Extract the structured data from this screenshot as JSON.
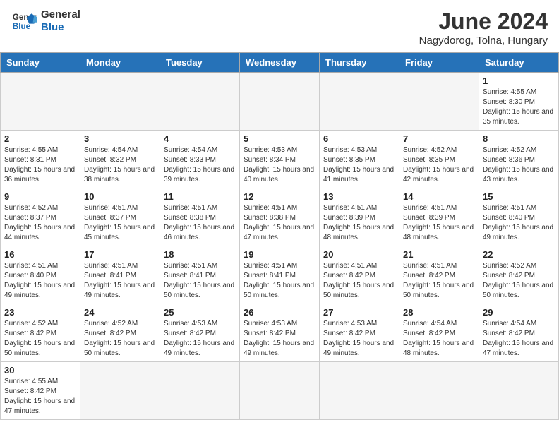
{
  "header": {
    "logo_general": "General",
    "logo_blue": "Blue",
    "title": "June 2024",
    "subtitle": "Nagydorog, Tolna, Hungary"
  },
  "weekdays": [
    "Sunday",
    "Monday",
    "Tuesday",
    "Wednesday",
    "Thursday",
    "Friday",
    "Saturday"
  ],
  "weeks": [
    [
      {
        "day": "",
        "info": ""
      },
      {
        "day": "",
        "info": ""
      },
      {
        "day": "",
        "info": ""
      },
      {
        "day": "",
        "info": ""
      },
      {
        "day": "",
        "info": ""
      },
      {
        "day": "",
        "info": ""
      },
      {
        "day": "1",
        "info": "Sunrise: 4:55 AM\nSunset: 8:30 PM\nDaylight: 15 hours and 35 minutes."
      }
    ],
    [
      {
        "day": "2",
        "info": "Sunrise: 4:55 AM\nSunset: 8:31 PM\nDaylight: 15 hours and 36 minutes."
      },
      {
        "day": "3",
        "info": "Sunrise: 4:54 AM\nSunset: 8:32 PM\nDaylight: 15 hours and 38 minutes."
      },
      {
        "day": "4",
        "info": "Sunrise: 4:54 AM\nSunset: 8:33 PM\nDaylight: 15 hours and 39 minutes."
      },
      {
        "day": "5",
        "info": "Sunrise: 4:53 AM\nSunset: 8:34 PM\nDaylight: 15 hours and 40 minutes."
      },
      {
        "day": "6",
        "info": "Sunrise: 4:53 AM\nSunset: 8:35 PM\nDaylight: 15 hours and 41 minutes."
      },
      {
        "day": "7",
        "info": "Sunrise: 4:52 AM\nSunset: 8:35 PM\nDaylight: 15 hours and 42 minutes."
      },
      {
        "day": "8",
        "info": "Sunrise: 4:52 AM\nSunset: 8:36 PM\nDaylight: 15 hours and 43 minutes."
      }
    ],
    [
      {
        "day": "9",
        "info": "Sunrise: 4:52 AM\nSunset: 8:37 PM\nDaylight: 15 hours and 44 minutes."
      },
      {
        "day": "10",
        "info": "Sunrise: 4:51 AM\nSunset: 8:37 PM\nDaylight: 15 hours and 45 minutes."
      },
      {
        "day": "11",
        "info": "Sunrise: 4:51 AM\nSunset: 8:38 PM\nDaylight: 15 hours and 46 minutes."
      },
      {
        "day": "12",
        "info": "Sunrise: 4:51 AM\nSunset: 8:38 PM\nDaylight: 15 hours and 47 minutes."
      },
      {
        "day": "13",
        "info": "Sunrise: 4:51 AM\nSunset: 8:39 PM\nDaylight: 15 hours and 48 minutes."
      },
      {
        "day": "14",
        "info": "Sunrise: 4:51 AM\nSunset: 8:39 PM\nDaylight: 15 hours and 48 minutes."
      },
      {
        "day": "15",
        "info": "Sunrise: 4:51 AM\nSunset: 8:40 PM\nDaylight: 15 hours and 49 minutes."
      }
    ],
    [
      {
        "day": "16",
        "info": "Sunrise: 4:51 AM\nSunset: 8:40 PM\nDaylight: 15 hours and 49 minutes."
      },
      {
        "day": "17",
        "info": "Sunrise: 4:51 AM\nSunset: 8:41 PM\nDaylight: 15 hours and 49 minutes."
      },
      {
        "day": "18",
        "info": "Sunrise: 4:51 AM\nSunset: 8:41 PM\nDaylight: 15 hours and 50 minutes."
      },
      {
        "day": "19",
        "info": "Sunrise: 4:51 AM\nSunset: 8:41 PM\nDaylight: 15 hours and 50 minutes."
      },
      {
        "day": "20",
        "info": "Sunrise: 4:51 AM\nSunset: 8:42 PM\nDaylight: 15 hours and 50 minutes."
      },
      {
        "day": "21",
        "info": "Sunrise: 4:51 AM\nSunset: 8:42 PM\nDaylight: 15 hours and 50 minutes."
      },
      {
        "day": "22",
        "info": "Sunrise: 4:52 AM\nSunset: 8:42 PM\nDaylight: 15 hours and 50 minutes."
      }
    ],
    [
      {
        "day": "23",
        "info": "Sunrise: 4:52 AM\nSunset: 8:42 PM\nDaylight: 15 hours and 50 minutes."
      },
      {
        "day": "24",
        "info": "Sunrise: 4:52 AM\nSunset: 8:42 PM\nDaylight: 15 hours and 50 minutes."
      },
      {
        "day": "25",
        "info": "Sunrise: 4:53 AM\nSunset: 8:42 PM\nDaylight: 15 hours and 49 minutes."
      },
      {
        "day": "26",
        "info": "Sunrise: 4:53 AM\nSunset: 8:42 PM\nDaylight: 15 hours and 49 minutes."
      },
      {
        "day": "27",
        "info": "Sunrise: 4:53 AM\nSunset: 8:42 PM\nDaylight: 15 hours and 49 minutes."
      },
      {
        "day": "28",
        "info": "Sunrise: 4:54 AM\nSunset: 8:42 PM\nDaylight: 15 hours and 48 minutes."
      },
      {
        "day": "29",
        "info": "Sunrise: 4:54 AM\nSunset: 8:42 PM\nDaylight: 15 hours and 47 minutes."
      }
    ],
    [
      {
        "day": "30",
        "info": "Sunrise: 4:55 AM\nSunset: 8:42 PM\nDaylight: 15 hours and 47 minutes."
      },
      {
        "day": "",
        "info": ""
      },
      {
        "day": "",
        "info": ""
      },
      {
        "day": "",
        "info": ""
      },
      {
        "day": "",
        "info": ""
      },
      {
        "day": "",
        "info": ""
      },
      {
        "day": "",
        "info": ""
      }
    ]
  ]
}
